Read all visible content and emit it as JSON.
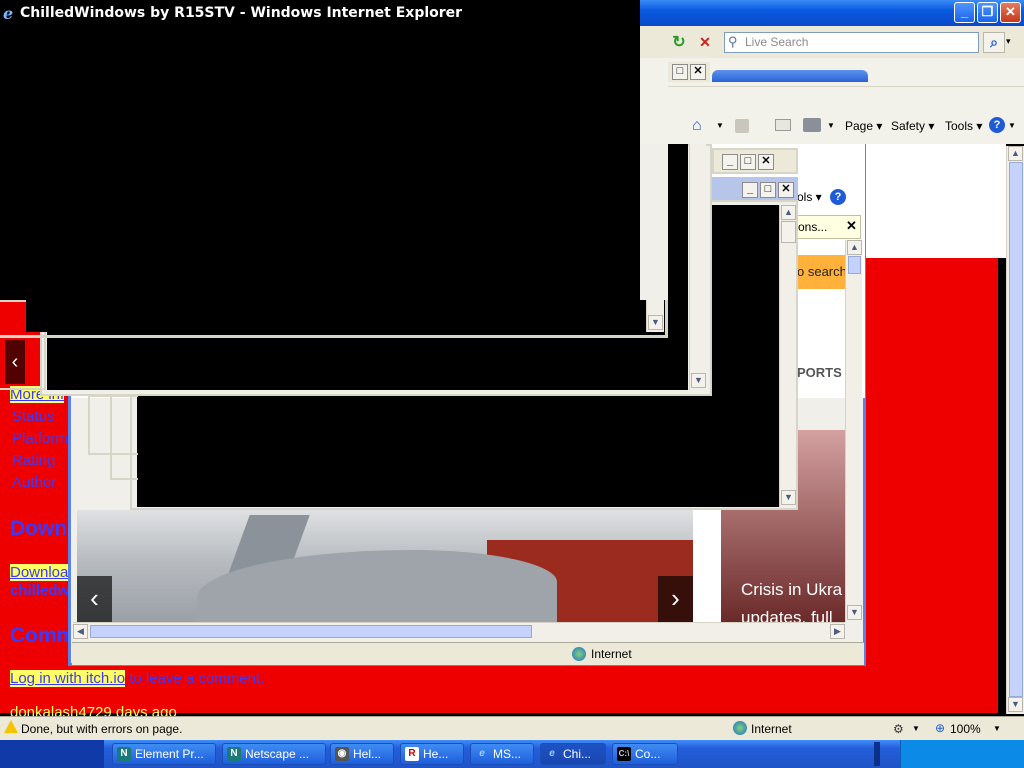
{
  "window": {
    "title": "ChilledWindows by R15STV - Windows Internet Explorer",
    "minimize": "_",
    "maximize": "❐",
    "close": "✕"
  },
  "toolbar": {
    "search_placeholder": "Live Search",
    "refresh_glyph": "↻",
    "stop_glyph": "✕",
    "search_go": "⌕"
  },
  "commandbar": {
    "page": "Page ▾",
    "safety": "Safety ▾",
    "tools": "Tools ▾",
    "help": "? ▾",
    "inner_tools": "ols ▾"
  },
  "inner_window": {
    "tab_fragment": "ons...",
    "search_fragment": "o search",
    "sports_fragment": "PORTS",
    "status_zone": "Internet"
  },
  "page": {
    "links": {
      "more_info": "More inf",
      "status": "Status",
      "platform": "Platform",
      "rating": "Rating",
      "author": "Author"
    },
    "download_heading": "Down",
    "download_link": "Downloa",
    "download_file": "chilledw",
    "comments_heading": "Comm",
    "login_link": "Log in with itch.io",
    "login_suffix": " to leave a comment.",
    "commenter": "donkalash4729 days ago"
  },
  "news": {
    "headline_1": "Crisis in Ukra",
    "headline_2": "updates, full"
  },
  "statusbar": {
    "message": "Done, but with errors on page.",
    "zone": "Internet",
    "zoom": "100%"
  },
  "taskbar": {
    "items": [
      "Element Pr...",
      "Netscape ...",
      "Hel...",
      "He...",
      "MS...",
      "Chi...",
      "Co..."
    ]
  }
}
